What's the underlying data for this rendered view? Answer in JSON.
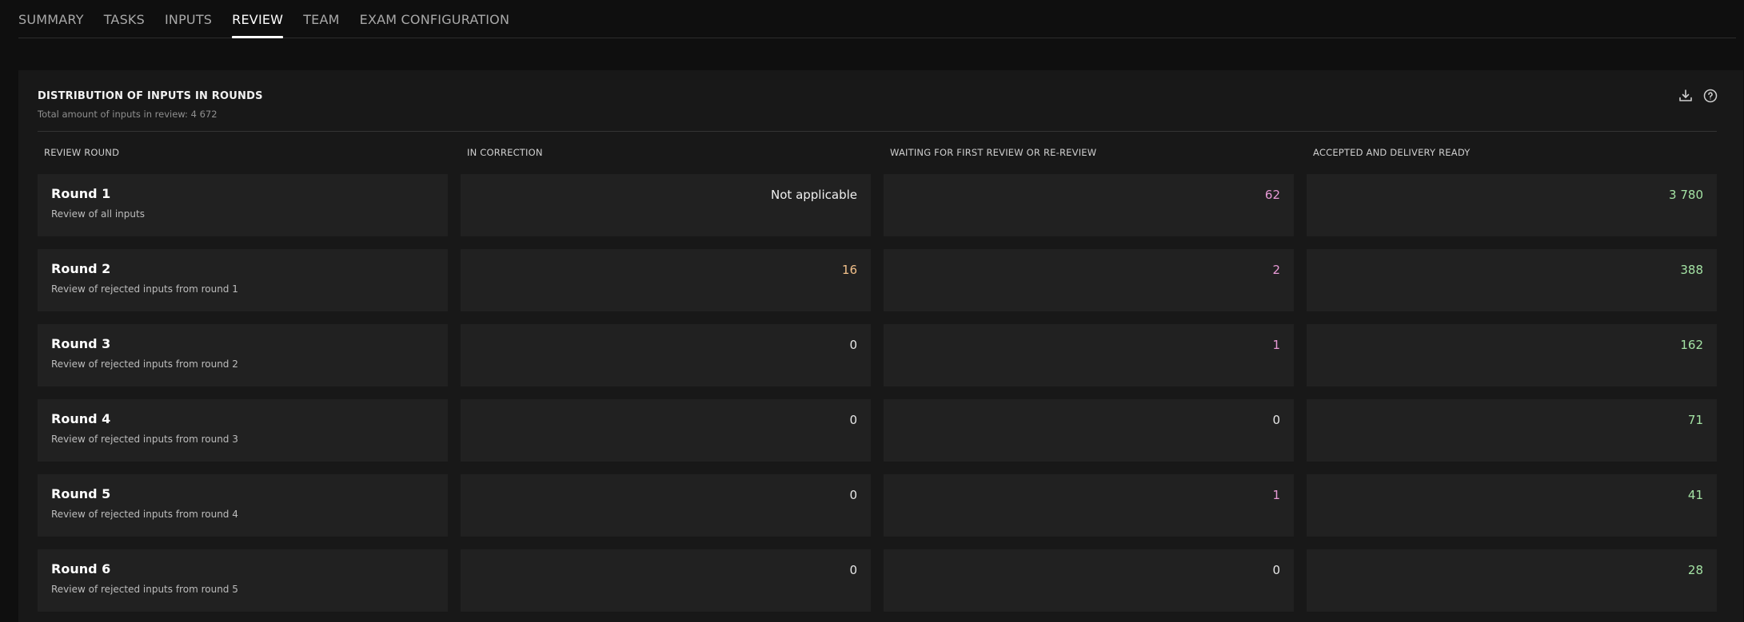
{
  "tabs": [
    {
      "label": "SUMMARY",
      "active": false
    },
    {
      "label": "TASKS",
      "active": false
    },
    {
      "label": "INPUTS",
      "active": false
    },
    {
      "label": "REVIEW",
      "active": true
    },
    {
      "label": "TEAM",
      "active": false
    },
    {
      "label": "EXAM CONFIGURATION",
      "active": false
    }
  ],
  "panel": {
    "title": "DISTRIBUTION OF INPUTS IN ROUNDS",
    "subtitle_label": "Total amount of inputs in review:",
    "subtitle_value": "4 672",
    "icons": [
      "download-icon",
      "help-icon"
    ]
  },
  "columns": [
    "REVIEW ROUND",
    "IN CORRECTION",
    "WAITING FOR FIRST REVIEW OR RE-REVIEW",
    "ACCEPTED AND DELIVERY READY"
  ],
  "rounds": [
    {
      "title": "Round 1",
      "desc": "Review of all inputs",
      "in_correction": "Not applicable",
      "waiting": "62",
      "accepted": "3 780"
    },
    {
      "title": "Round 2",
      "desc": "Review of rejected inputs from round 1",
      "in_correction": "16",
      "waiting": "2",
      "accepted": "388"
    },
    {
      "title": "Round 3",
      "desc": "Review of rejected inputs from round 2",
      "in_correction": "0",
      "waiting": "1",
      "accepted": "162"
    },
    {
      "title": "Round 4",
      "desc": "Review of rejected inputs from round 3",
      "in_correction": "0",
      "waiting": "0",
      "accepted": "71"
    },
    {
      "title": "Round 5",
      "desc": "Review of rejected inputs from round 4",
      "in_correction": "0",
      "waiting": "1",
      "accepted": "41"
    },
    {
      "title": "Round 6",
      "desc": "Review of rejected inputs from round 5",
      "in_correction": "0",
      "waiting": "0",
      "accepted": "28"
    }
  ],
  "colors": {
    "background": "#0f0f0f",
    "panel": "#181818",
    "cell": "#212121",
    "in_correction_nonzero": "#f2c08a",
    "waiting_nonzero": "#e89ad6",
    "accepted": "#a4e3a4"
  }
}
